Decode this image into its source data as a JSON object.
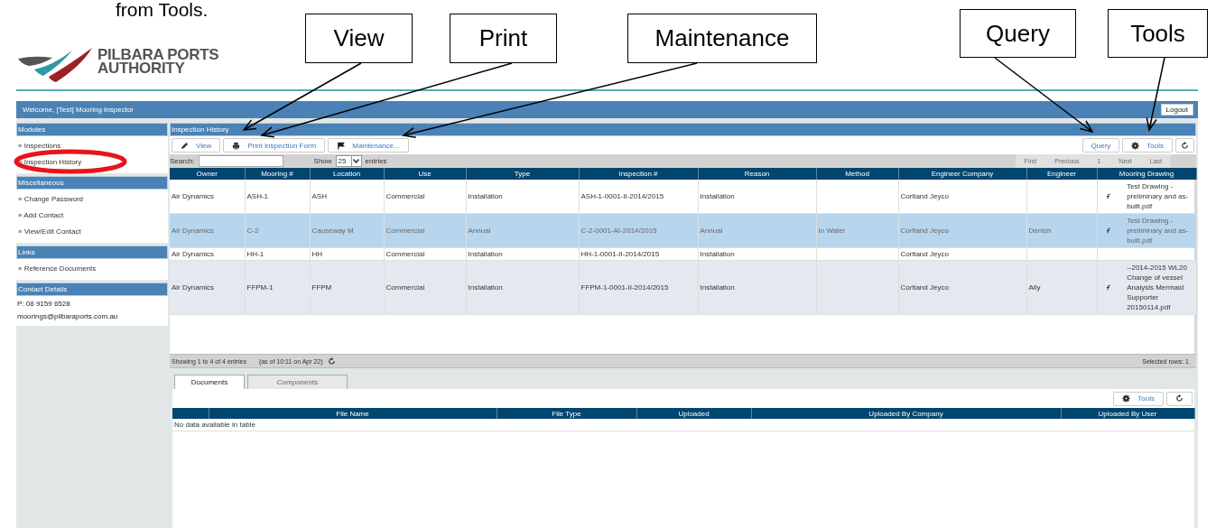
{
  "document_text": "from Tools.",
  "logo": {
    "line_1": "PILBARA PORTS",
    "line_2": "AUTHORITY"
  },
  "header": {
    "welcome": "Welcome, [Test] Mooring Inspector",
    "logout": "Logout"
  },
  "sidebar": {
    "sections": [
      {
        "title": "Modules",
        "items": [
          {
            "kind": "link",
            "label": "» Inspections"
          },
          {
            "kind": "link",
            "label": "» Inspection History"
          }
        ]
      },
      {
        "title": "Miscellaneous",
        "items": [
          {
            "kind": "link",
            "label": "» Change Password"
          },
          {
            "kind": "link",
            "label": "» Add Contact"
          },
          {
            "kind": "link",
            "label": "» View/Edit Contact"
          }
        ]
      },
      {
        "title": "Links",
        "items": [
          {
            "kind": "link",
            "label": "» Reference Documents"
          }
        ]
      },
      {
        "title": "Contact Details",
        "items": [
          {
            "kind": "text",
            "label": "P: 08 9159 6528"
          },
          {
            "kind": "text",
            "label": "moorings@pilbaraports.com.au"
          }
        ]
      }
    ]
  },
  "main": {
    "title": "Inspection History",
    "toolbar_left": [
      {
        "kind": "edit",
        "label": "View"
      },
      {
        "kind": "print",
        "label": "Print Inspection Form"
      },
      {
        "kind": "flag",
        "label": "Maintenance..."
      }
    ],
    "toolbar_right": [
      {
        "kind": "plain",
        "label": "Query"
      },
      {
        "kind": "gear",
        "label": "Tools"
      },
      {
        "kind": "refresh"
      }
    ],
    "search": {
      "label": "Search:"
    },
    "page_size": {
      "label_before": "Show",
      "value": "25",
      "label_after": "entries"
    },
    "pagination": [
      {
        "label": "First",
        "disabled": true
      },
      {
        "label": "Previous",
        "disabled": true
      },
      {
        "label": "1",
        "disabled": true
      },
      {
        "label": "Next",
        "disabled": true
      },
      {
        "label": "Last",
        "disabled": true
      }
    ],
    "table": {
      "columns": [
        "Owner",
        "Mooring #",
        "Location",
        "Use",
        "Type",
        "Inspection #",
        "Reason",
        "Method",
        "Engineer Company",
        "Engineer",
        "Mooring Drawing"
      ],
      "rows": [
        {
          "selected": false,
          "owner": "Air Dynamics",
          "mooring": "ASH-1",
          "location": "ASH",
          "use": "Commercial",
          "type": "Installation",
          "inspection": "ASH-1-0001-II-2014/2015",
          "reason": "Installation",
          "engineer_company": "Cortland Jeyco",
          "drawing": "Test Drawing - preliminary and as-built.pdf"
        },
        {
          "selected": true,
          "owner": "Air Dynamics",
          "mooring": "C-2",
          "location": "Causeway M",
          "use": "Commercial",
          "type": "Annual",
          "inspection": "C-2-0001-AI-2014/2015",
          "reason": "Annual",
          "method": "In Water",
          "engineer_company": "Cortland Jeyco",
          "engineer": "Denish",
          "drawing": "Test Drawing - preliminary and as-built.pdf"
        },
        {
          "selected": false,
          "owner": "Air Dynamics",
          "mooring": "HH-1",
          "location": "HH",
          "use": "Commercial",
          "type": "Installation",
          "inspection": "HH-1-0001-II-2014/2015",
          "reason": "Installation",
          "engineer_company": "Cortland Jeyco"
        },
        {
          "selected": false,
          "owner": "Air Dynamics",
          "mooring": "FFPM-1",
          "location": "FFPM",
          "use": "Commercial",
          "type": "Installation",
          "inspection": "FFPM-1-0001-II-2014/2015",
          "reason": "Installation",
          "engineer_company": "Cortland Jeyco",
          "engineer": "Ally",
          "drawing": "--2014-2015 WL20 Change of vessel Analysis Mermaid Supporter 20150114.pdf"
        }
      ]
    },
    "footer": {
      "info": "Showing 1 to 4 of 4 entries",
      "updated": "(as of 10:11 on Apr 22)",
      "selected_rows": "Selected rows: 1"
    }
  },
  "details": {
    "tabs": [
      {
        "label": "Documents",
        "selected": true
      },
      {
        "label": "Components",
        "selected": false
      }
    ],
    "toolbar": [
      {
        "kind": "gear",
        "label": "Tools"
      },
      {
        "kind": "refresh"
      }
    ],
    "columns": [
      "File Name",
      "File Type",
      "Uploaded",
      "Uploaded By Company",
      "Uploaded By User"
    ],
    "empty_message": "No data available in table"
  },
  "annotations": {
    "callouts": [
      {
        "label": "View"
      },
      {
        "label": "Print"
      },
      {
        "label": "Maintenance"
      },
      {
        "label": "Query"
      },
      {
        "label": "Tools"
      }
    ],
    "highlight": {
      "kind": "ellipse"
    }
  }
}
